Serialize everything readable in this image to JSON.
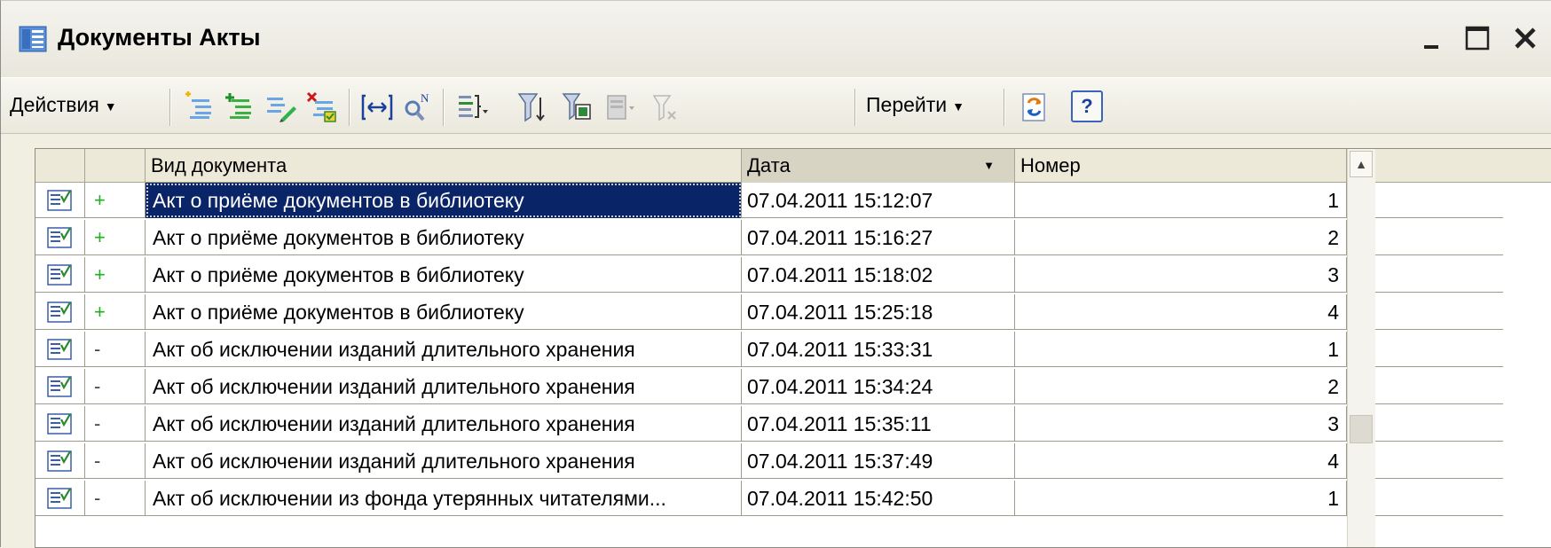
{
  "window": {
    "title": "Документы Акты",
    "minimize_label": "_",
    "maximize_label": "☐",
    "close_label": "✕"
  },
  "toolbar": {
    "actions_label": "Действия",
    "goto_label": "Перейти",
    "help_label": "?",
    "icons": [
      "add-icon",
      "add-copy-icon",
      "edit-icon",
      "delete-mark-icon",
      "interval-icon",
      "find-icon",
      "hierarchy-icon",
      "filter-icon",
      "filter-value-icon",
      "filter-history-icon",
      "clear-filter-icon",
      "refresh-icon",
      "help-icon"
    ]
  },
  "grid": {
    "columns": [
      "Вид документа",
      "Дата",
      "Номер"
    ],
    "sort_column": "Дата",
    "rows": [
      {
        "mark": "+",
        "kind": "Акт о приёме документов в библиотеку",
        "date": "07.04.2011 15:12:07",
        "number": "1",
        "selected": true
      },
      {
        "mark": "+",
        "kind": "Акт о приёме документов в библиотеку",
        "date": "07.04.2011 15:16:27",
        "number": "2"
      },
      {
        "mark": "+",
        "kind": "Акт о приёме документов в библиотеку",
        "date": "07.04.2011 15:18:02",
        "number": "3"
      },
      {
        "mark": "+",
        "kind": "Акт о приёме документов в библиотеку",
        "date": "07.04.2011 15:25:18",
        "number": "4"
      },
      {
        "mark": "-",
        "kind": "Акт об исключении изданий длительного хранения",
        "date": "07.04.2011 15:33:31",
        "number": "1"
      },
      {
        "mark": "-",
        "kind": "Акт об исключении изданий длительного хранения",
        "date": "07.04.2011 15:34:24",
        "number": "2"
      },
      {
        "mark": "-",
        "kind": "Акт об исключении изданий длительного хранения",
        "date": "07.04.2011 15:35:11",
        "number": "3"
      },
      {
        "mark": "-",
        "kind": "Акт об исключении изданий длительного хранения",
        "date": "07.04.2011 15:37:49",
        "number": "4"
      },
      {
        "mark": "-",
        "kind": "Акт об исключении из фонда утерянных читателями...",
        "date": "07.04.2011 15:42:50",
        "number": "1"
      }
    ]
  },
  "colors": {
    "selection": "#0a2468",
    "plus_mark": "#20b020",
    "window_bg": "#f1efe2"
  }
}
